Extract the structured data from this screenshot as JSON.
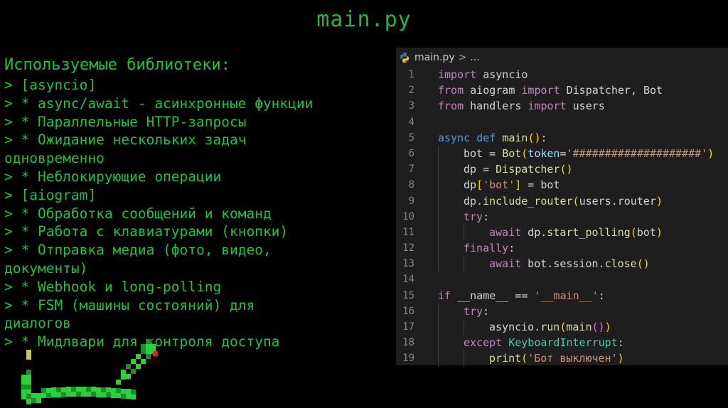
{
  "slide": {
    "title": "main.py"
  },
  "notes": {
    "heading": "Используемые библиотеки:",
    "lines": [
      "> [asyncio]",
      "> * async/await - асинхронные функции",
      "> * Параллельные HTTP-запросы",
      "> * Ожидание нескольких задач",
      "одновременно",
      "> * Неблокирующие операции",
      "> [aiogram]",
      "> * Обработка сообщений и команд",
      "> * Работа с клавиатурами (кнопки)",
      "> * Отправка медиа (фото, видео,",
      "документы)",
      "> * Webhook и long-polling",
      "> * FSM (машины состояний) для",
      "диалогов",
      "> * Мидлвари для контроля доступа"
    ]
  },
  "editor": {
    "breadcrumb_file": "main.py",
    "breadcrumb_separator": ">",
    "breadcrumb_more": "...",
    "file_icon": "python-icon",
    "lines": [
      {
        "n": "1",
        "indent": 0,
        "tokens": [
          [
            "kw2",
            "import"
          ],
          [
            "pl",
            " asyncio"
          ]
        ]
      },
      {
        "n": "2",
        "indent": 0,
        "tokens": [
          [
            "kw2",
            "from"
          ],
          [
            "pl",
            " aiogram "
          ],
          [
            "kw2",
            "import"
          ],
          [
            "pl",
            " Dispatcher, Bot"
          ]
        ]
      },
      {
        "n": "3",
        "indent": 0,
        "tokens": [
          [
            "kw2",
            "from"
          ],
          [
            "pl",
            " handlers "
          ],
          [
            "kw2",
            "import"
          ],
          [
            "pl",
            " users"
          ]
        ]
      },
      {
        "n": "4",
        "indent": 0,
        "tokens": []
      },
      {
        "n": "5",
        "indent": 0,
        "tokens": [
          [
            "kw",
            "async"
          ],
          [
            "pl",
            " "
          ],
          [
            "kw",
            "def"
          ],
          [
            "pl",
            " "
          ],
          [
            "fn",
            "main"
          ],
          [
            "br1",
            "()"
          ],
          [
            "pl",
            ":"
          ]
        ]
      },
      {
        "n": "6",
        "indent": 1,
        "tokens": [
          [
            "pl",
            "bot = "
          ],
          [
            "fn",
            "Bot"
          ],
          [
            "br1",
            "("
          ],
          [
            "par",
            "token"
          ],
          [
            "pl",
            "="
          ],
          [
            "str",
            "'####################'"
          ],
          [
            "br1",
            ")"
          ]
        ]
      },
      {
        "n": "7",
        "indent": 1,
        "tokens": [
          [
            "pl",
            "dp = "
          ],
          [
            "fn",
            "Dispatcher"
          ],
          [
            "br1",
            "()"
          ]
        ]
      },
      {
        "n": "8",
        "indent": 1,
        "tokens": [
          [
            "pl",
            "dp"
          ],
          [
            "br1",
            "["
          ],
          [
            "str",
            "'bot'"
          ],
          [
            "br1",
            "]"
          ],
          [
            "pl",
            " = bot"
          ]
        ]
      },
      {
        "n": "9",
        "indent": 1,
        "tokens": [
          [
            "pl",
            "dp."
          ],
          [
            "fn",
            "include_router"
          ],
          [
            "br1",
            "("
          ],
          [
            "pl",
            "users.router"
          ],
          [
            "br1",
            ")"
          ]
        ]
      },
      {
        "n": "10",
        "indent": 1,
        "tokens": [
          [
            "ctl",
            "try"
          ],
          [
            "pl",
            ":"
          ]
        ]
      },
      {
        "n": "11",
        "indent": 2,
        "tokens": [
          [
            "ctl",
            "await"
          ],
          [
            "pl",
            " dp."
          ],
          [
            "fn",
            "start_polling"
          ],
          [
            "br1",
            "("
          ],
          [
            "pl",
            "bot"
          ],
          [
            "br1",
            ")"
          ]
        ]
      },
      {
        "n": "12",
        "indent": 1,
        "tokens": [
          [
            "ctl",
            "finally"
          ],
          [
            "pl",
            ":"
          ]
        ]
      },
      {
        "n": "13",
        "indent": 2,
        "tokens": [
          [
            "ctl",
            "await"
          ],
          [
            "pl",
            " bot.session."
          ],
          [
            "fn",
            "close"
          ],
          [
            "br1",
            "()"
          ]
        ]
      },
      {
        "n": "14",
        "indent": 0,
        "tokens": []
      },
      {
        "n": "15",
        "indent": 0,
        "tokens": [
          [
            "ctl",
            "if"
          ],
          [
            "pl",
            " __name__ == "
          ],
          [
            "str",
            "'__main__'"
          ],
          [
            "pl",
            ":"
          ]
        ]
      },
      {
        "n": "16",
        "indent": 1,
        "tokens": [
          [
            "ctl",
            "try"
          ],
          [
            "pl",
            ":"
          ]
        ]
      },
      {
        "n": "17",
        "indent": 2,
        "tokens": [
          [
            "pl",
            "asyncio."
          ],
          [
            "fn",
            "run"
          ],
          [
            "br1",
            "("
          ],
          [
            "fn",
            "main"
          ],
          [
            "br2",
            "()"
          ],
          [
            "br1",
            ")"
          ]
        ]
      },
      {
        "n": "18",
        "indent": 1,
        "tokens": [
          [
            "ctl",
            "except"
          ],
          [
            "pl",
            " "
          ],
          [
            "cls",
            "KeyboardInterrupt"
          ],
          [
            "pl",
            ":"
          ]
        ]
      },
      {
        "n": "19",
        "indent": 2,
        "tokens": [
          [
            "fn",
            "print"
          ],
          [
            "br1",
            "("
          ],
          [
            "str",
            "'Бот выключен'"
          ],
          [
            "br1",
            ")"
          ]
        ]
      }
    ]
  },
  "colors": {
    "notes_text": "#20c23c",
    "title_text": "#22b83a",
    "editor_bg": "#1e1e1e",
    "snake_green": "#2bd13b",
    "snake_dark": "#1a8f28",
    "snake_tail": "#c8c840",
    "snake_tongue": "#ff1a1a"
  }
}
